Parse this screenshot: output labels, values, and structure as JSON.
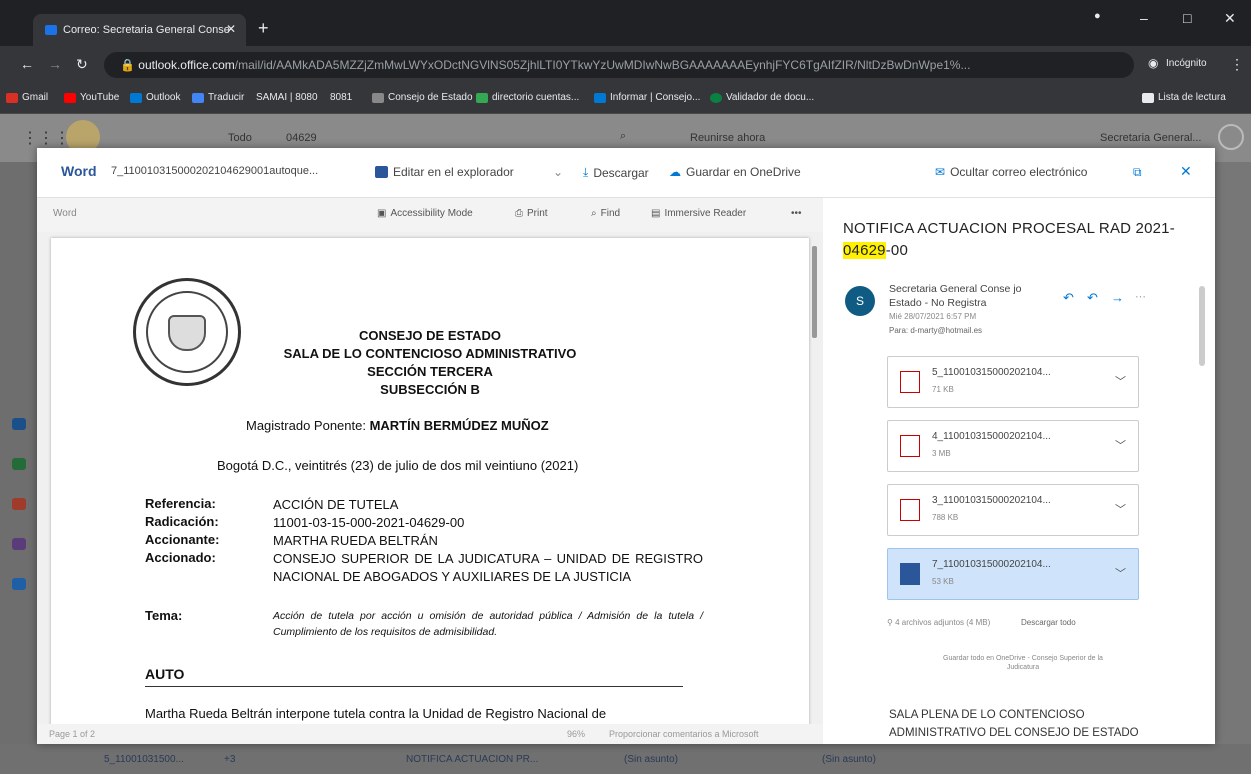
{
  "browser": {
    "tab_title": "Correo: Secretaria General Conse",
    "close": "✕",
    "new_tab": "+",
    "url_host": "outlook.office.com",
    "url_path": "/mail/id/AAMkADA5MZZjZmMwLWYxODctNGVlNS05ZjhlLTI0YTkwYzUwMDIwNwBGAAAAAAAEynhjFYC6TgAIfZIR/NltDzBwDnWpe1%...",
    "incognito": "Incógnito",
    "minimize": "–",
    "maximize": "□",
    "close_win": "✕"
  },
  "bookmarks": [
    {
      "label": "Gmail",
      "color": "#d93025"
    },
    {
      "label": "YouTube",
      "color": "#ff0000"
    },
    {
      "label": "Outlook",
      "color": "#0078d4"
    },
    {
      "label": "Traducir",
      "color": "#4285f4"
    },
    {
      "label": "SAMAI | 8080",
      "color": "#888888"
    },
    {
      "label": "8081",
      "color": "#888888"
    },
    {
      "label": "Consejo de Estado",
      "color": "#888888"
    },
    {
      "label": "directorio cuentas...",
      "color": "#34a853"
    },
    {
      "label": "Informar | Consejo...",
      "color": "#0078d4"
    },
    {
      "label": "Validador de docu...",
      "color": "#0b8043"
    }
  ],
  "bookmarks_right": "Lista de lectura",
  "owa": {
    "search_scope": "Todo",
    "search_text": "04629",
    "meet_now": "Reunirse ahora",
    "user": "Secretaria General..."
  },
  "modal": {
    "word_label": "Word",
    "filename": "7_110010315000202104629001autoque...",
    "edit_browser": "Editar en el explorador",
    "download": "Descargar",
    "save_onedrive": "Guardar en OneDrive",
    "hide_email": "Ocultar correo electrónico",
    "close": "✕"
  },
  "viewer": {
    "app": "Word",
    "accessibility": "Accessibility Mode",
    "print": "Print",
    "find": "Find",
    "immersive": "Immersive Reader",
    "more": "•••",
    "page_info": "Page 1 of 2",
    "zoom": "96%",
    "feedback": "Proporcionar comentarios a Microsoft"
  },
  "document": {
    "h1": "CONSEJO DE ESTADO",
    "h2": "SALA DE LO CONTENCIOSO ADMINISTRATIVO",
    "h3": "SECCIÓN TERCERA",
    "h4": "SUBSECCIÓN B",
    "magistrado_label": "Magistrado Ponente: ",
    "magistrado": "MARTÍN BERMÚDEZ MUÑOZ",
    "date": "Bogotá D.C., veintitrés (23) de julio de dos mil veintiuno (2021)",
    "fields": [
      {
        "label": "Referencia:",
        "value": "ACCIÓN DE TUTELA"
      },
      {
        "label": "Radicación:",
        "value": "11001-03-15-000-2021-04629-00"
      },
      {
        "label": "Accionante:",
        "value": "MARTHA RUEDA BELTRÁN"
      },
      {
        "label": "Accionado:",
        "value": "CONSEJO SUPERIOR DE LA JUDICATURA – UNIDAD DE REGISTRO NACIONAL DE ABOGADOS Y AUXILIARES DE LA JUSTICIA"
      },
      {
        "label": "Tema:",
        "value": "Acción de tutela por acción u omisión de autoridad pública / Admisión de la tutela / Cumplimiento de los requisitos de admisibilidad."
      }
    ],
    "auto": "AUTO",
    "body": "Martha Rueda Beltrán interpone tutela contra la Unidad de Registro Nacional de"
  },
  "email": {
    "subject_pre": "NOTIFICA ACTUACION PROCESAL RAD 2021-",
    "subject_hl": "04629",
    "subject_post": "-00",
    "avatar": "S",
    "sender": "Secretaria General Conse jo Estado - No Registra",
    "date": "Mié 28/07/2021 6:57 PM",
    "to": "Para: d-marty@hotmail.es",
    "attachments": [
      {
        "name": "5_110010315000202104...",
        "size": "71 KB",
        "type": "pdf"
      },
      {
        "name": "4_110010315000202104...",
        "size": "3 MB",
        "type": "pdf"
      },
      {
        "name": "3_110010315000202104...",
        "size": "788 KB",
        "type": "pdf"
      },
      {
        "name": "7_110010315000202104...",
        "size": "53 KB",
        "type": "word"
      }
    ],
    "summary": "4 archivos adjuntos (4 MB)",
    "download_all": "Descargar todo",
    "save_all": "Guardar todo en OneDrive - Consejo Superior de la Judicatura",
    "body": "SALA PLENA DE LO CONTENCIOSO ADMINISTRATIVO DEL CONSEJO DE ESTADO"
  },
  "taskbar": {
    "item1": "5_11001031500...",
    "item1_extra": "+3",
    "item2": "NOTIFICA ACTUACION PR...",
    "item3": "(Sin asunto)",
    "item4": "(Sin asunto)"
  }
}
